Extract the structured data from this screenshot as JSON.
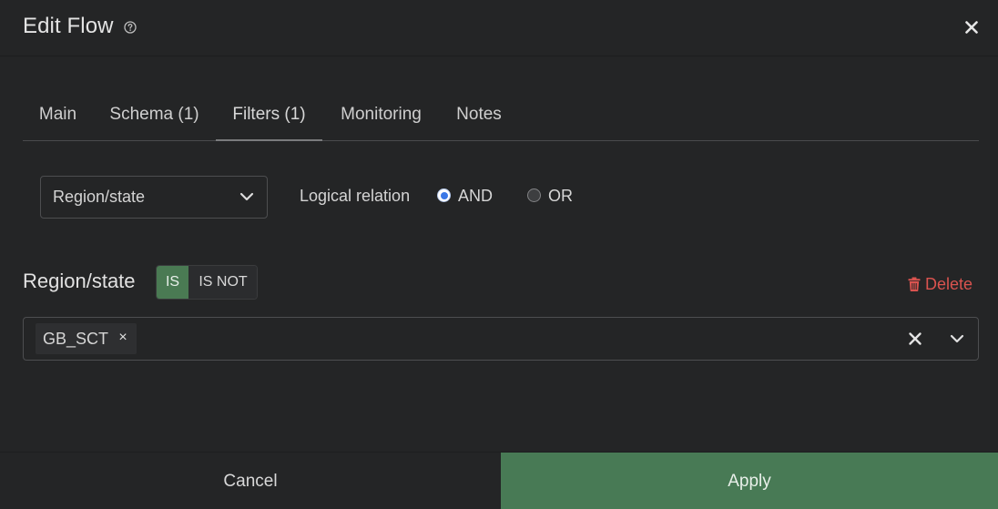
{
  "dialog": {
    "title": "Edit Flow",
    "help_icon": "question-circle-icon",
    "close_icon": "close-icon"
  },
  "tabs": [
    {
      "label": "Main",
      "active": false
    },
    {
      "label": "Schema (1)",
      "active": false
    },
    {
      "label": "Filters (1)",
      "active": true
    },
    {
      "label": "Monitoring",
      "active": false
    },
    {
      "label": "Notes",
      "active": false
    }
  ],
  "filter_select": {
    "value": "Region/state",
    "icon": "chevron-down-icon"
  },
  "logical_relation": {
    "label": "Logical relation",
    "options": [
      {
        "label": "AND",
        "checked": true
      },
      {
        "label": "OR",
        "checked": false
      }
    ]
  },
  "filter": {
    "label": "Region/state",
    "toggle": {
      "is_label": "IS",
      "is_not_label": "IS NOT",
      "selected": "IS"
    },
    "delete_label": "Delete",
    "delete_icon": "trash-icon",
    "values": [
      "GB_SCT"
    ],
    "chip_remove_label": "×"
  },
  "footer": {
    "cancel_label": "Cancel",
    "apply_label": "Apply"
  },
  "colors": {
    "background": "#242526",
    "accent_green": "#487a55",
    "delete_red": "#d9534f",
    "radio_blue": "#3b78e7"
  }
}
